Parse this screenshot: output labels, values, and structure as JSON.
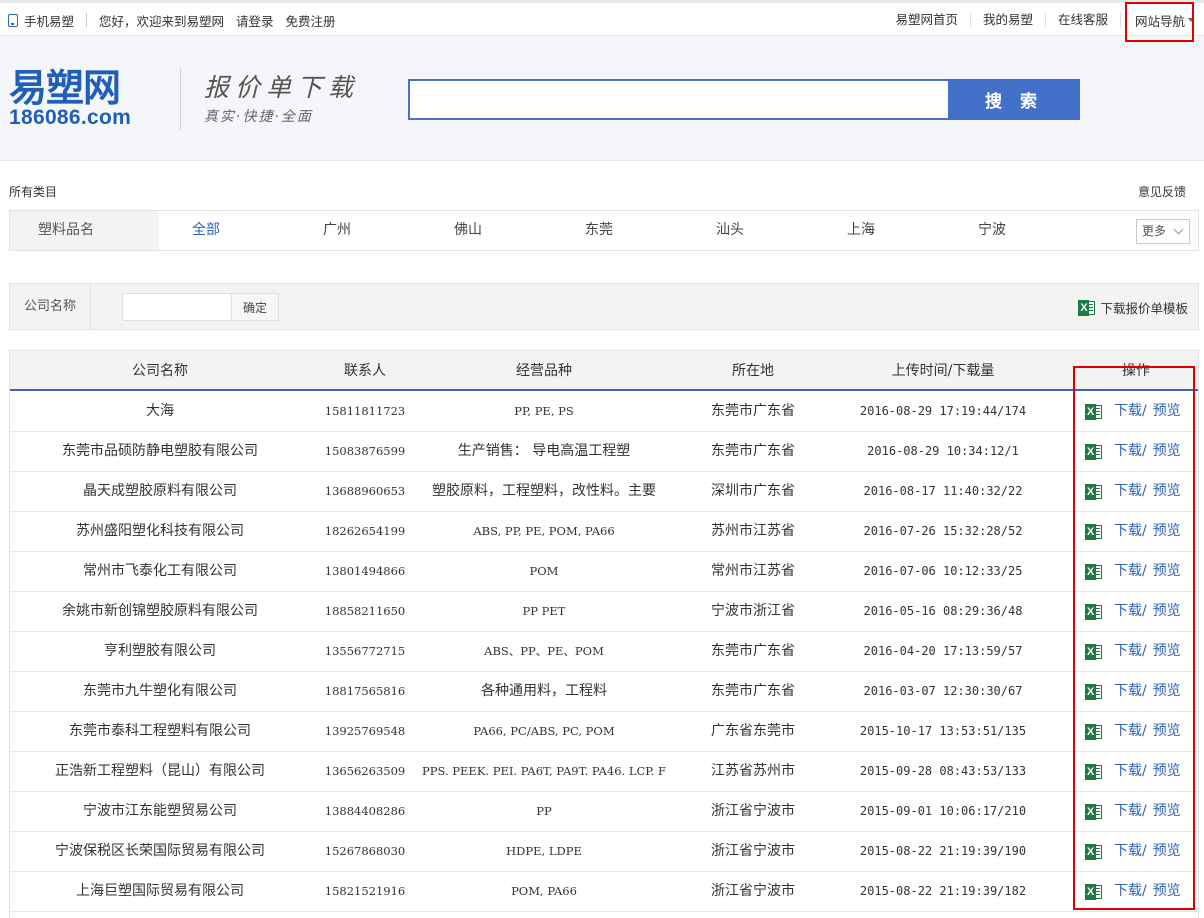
{
  "topbar": {
    "mobile": "手机易塑",
    "welcome": "您好，欢迎来到易塑网",
    "login": "请登录",
    "register": "免费注册",
    "home": "易塑网首页",
    "my": "我的易塑",
    "service": "在线客服",
    "nav": "网站导航"
  },
  "header": {
    "logo_cn": "易塑网",
    "logo_en": "186086.com",
    "slogan_title": "报价单下载",
    "slogan_sub": "真实·快捷·全面",
    "search_value": "",
    "search_button": "搜 索"
  },
  "category": {
    "all": "所有类目",
    "feedback": "意见反馈",
    "label": "塑料品名",
    "cities": [
      "全部",
      "广州",
      "佛山",
      "东莞",
      "汕头",
      "上海",
      "宁波"
    ],
    "active_city": "全部",
    "more": "更多"
  },
  "company_search": {
    "label": "公司名称",
    "value": "",
    "confirm": "确定",
    "template": "下载报价单模板"
  },
  "table": {
    "headers": [
      "公司名称",
      "联系人",
      "经营品种",
      "所在地",
      "上传时间/下载量",
      "操作"
    ],
    "download": "下载",
    "slash": "/",
    "preview": "预览",
    "rows": [
      {
        "name": "大海",
        "phone": "15811811723",
        "product": "PP, PE, PS",
        "loc": "东莞市广东省",
        "time": "2016-08-29 17:19:44/174"
      },
      {
        "name": "东莞市品硕防静电塑胶有限公司",
        "phone": "15083876599",
        "product": "生产销售： 导电高温工程塑",
        "loc": "东莞市广东省",
        "time": "2016-08-29 10:34:12/1"
      },
      {
        "name": "晶天成塑胶原料有限公司",
        "phone": "13688960653",
        "product": "塑胶原料，工程塑料，改性料。主要",
        "loc": "深圳市广东省",
        "time": "2016-08-17 11:40:32/22"
      },
      {
        "name": "苏州盛阳塑化科技有限公司",
        "phone": "18262654199",
        "product": "ABS, PP, PE, POM, PA66",
        "loc": "苏州市江苏省",
        "time": "2016-07-26 15:32:28/52"
      },
      {
        "name": "常州市飞泰化工有限公司",
        "phone": "13801494866",
        "product": "POM",
        "loc": "常州市江苏省",
        "time": "2016-07-06 10:12:33/25"
      },
      {
        "name": "余姚市新创锦塑胶原料有限公司",
        "phone": "18858211650",
        "product": "PP PET",
        "loc": "宁波市浙江省",
        "time": "2016-05-16 08:29:36/48"
      },
      {
        "name": "亨利塑胶有限公司",
        "phone": "13556772715",
        "product": "ABS、PP、PE、POM",
        "loc": "东莞市广东省",
        "time": "2016-04-20 17:13:59/57"
      },
      {
        "name": "东莞市九牛塑化有限公司",
        "phone": "18817565816",
        "product": "各种通用料，工程料",
        "loc": "东莞市广东省",
        "time": "2016-03-07 12:30:30/67"
      },
      {
        "name": "东莞市泰科工程塑料有限公司",
        "phone": "13925769548",
        "product": "PA66, PC/ABS, PC, POM",
        "loc": "广东省东莞市",
        "time": "2015-10-17 13:53:51/135"
      },
      {
        "name": "正浩新工程塑料（昆山）有限公司",
        "phone": "13656263509",
        "product": "PPS. PEEK. PEI. PA6T, PA9T. PA46. LCP. F",
        "loc": "江苏省苏州市",
        "time": "2015-09-28 08:43:53/133"
      },
      {
        "name": "宁波市江东能塑贸易公司",
        "phone": "13884408286",
        "product": "PP",
        "loc": "浙江省宁波市",
        "time": "2015-09-01 10:06:17/210"
      },
      {
        "name": "宁波保税区长荣国际贸易有限公司",
        "phone": "15267868030",
        "product": "HDPE, LDPE",
        "loc": "浙江省宁波市",
        "time": "2015-08-22 21:19:39/190"
      },
      {
        "name": "上海巨塑国际贸易有限公司",
        "phone": "15821521916",
        "product": "POM, PA66",
        "loc": "浙江省宁波市",
        "time": "2015-08-22 21:19:39/182"
      }
    ]
  },
  "icons": {
    "excel_letter": "X"
  },
  "colors": {
    "brand_blue": "#1f5fb8",
    "button_blue": "#4370c8",
    "link_blue": "#2e63b8",
    "excel_green": "#1e7a43",
    "highlight_red": "#e10000"
  }
}
